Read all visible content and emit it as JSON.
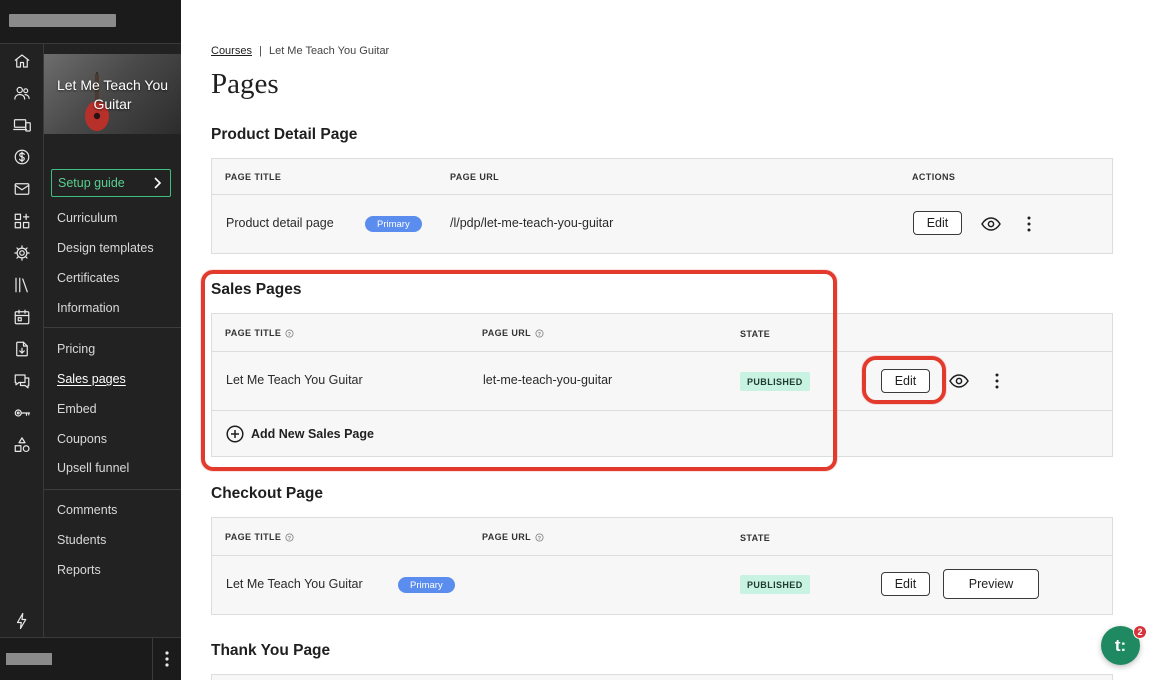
{
  "sidebar": {
    "course_title": "Let Me Teach You Guitar",
    "setup_label": "Setup guide",
    "group1": [
      "Curriculum",
      "Design templates",
      "Certificates",
      "Information"
    ],
    "group2": [
      "Pricing",
      "Sales pages",
      "Embed",
      "Coupons",
      "Upsell funnel"
    ],
    "group3": [
      "Comments",
      "Students",
      "Reports"
    ],
    "active_item": "Sales pages"
  },
  "rail_icons": [
    "home-icon",
    "users-icon",
    "devices-icon",
    "dollar-icon",
    "mail-icon",
    "apps-icon",
    "gear-icon",
    "library-icon",
    "calendar-icon",
    "download-icon",
    "chat-icon",
    "key-icon",
    "shapes-icon",
    "bolt-icon"
  ],
  "breadcrumb": {
    "root": "Courses",
    "separator": "|",
    "current": "Let Me Teach You Guitar"
  },
  "page": {
    "title": "Pages"
  },
  "product_detail": {
    "title": "Product Detail Page",
    "columns": {
      "title": "PAGE TITLE",
      "url": "PAGE URL",
      "actions": "ACTIONS"
    },
    "row": {
      "title": "Product detail page",
      "badge": "Primary",
      "url": "/l/pdp/let-me-teach-you-guitar",
      "edit": "Edit"
    }
  },
  "sales_pages": {
    "title": "Sales Pages",
    "columns": {
      "title": "PAGE TITLE",
      "url": "PAGE URL",
      "state": "STATE"
    },
    "row": {
      "title": "Let Me Teach You Guitar",
      "url": "let-me-teach-you-guitar",
      "state": "PUBLISHED",
      "edit": "Edit"
    },
    "add_label": "Add New Sales Page"
  },
  "checkout": {
    "title": "Checkout Page",
    "columns": {
      "title": "PAGE TITLE",
      "url": "PAGE URL",
      "state": "STATE"
    },
    "row": {
      "title": "Let Me Teach You Guitar",
      "badge": "Primary",
      "state": "PUBLISHED",
      "edit": "Edit",
      "preview": "Preview"
    }
  },
  "thank_you": {
    "title": "Thank You Page"
  },
  "chat": {
    "glyph": "t:",
    "badge": "2",
    "color": "#1f8a62"
  },
  "colors": {
    "highlight": "#e23b2e",
    "primary_badge": "#5b8def",
    "published_badge": "#c8f2e2",
    "setup_accent": "#3fbf7f"
  }
}
